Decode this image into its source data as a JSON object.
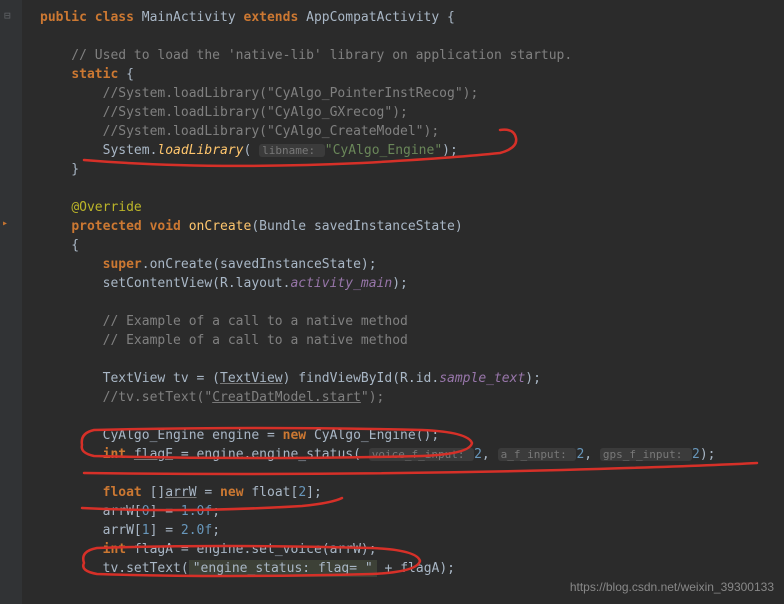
{
  "code": {
    "line1": "public class MainActivity extends AppCompatActivity {",
    "blank1": "",
    "comment_header": "    // Used to load the 'native-lib' library on application startup.",
    "static_open": "    static {",
    "static_c1": "        //System.loadLibrary(\"CyAlgo_PointerInstRecog\");",
    "static_c2": "        //System.loadLibrary(\"CyAlgo_GXrecog\");",
    "static_c3": "        //System.loadLibrary(\"CyAlgo_CreateModel\");",
    "loadlib_pre": "        System.",
    "loadlib_method": "loadLibrary",
    "loadlib_open": "( ",
    "loadlib_hint": "libname: ",
    "loadlib_str": "\"CyAlgo_Engine\"",
    "loadlib_close": ");",
    "static_close": "    }",
    "blank2": "",
    "override": "    @Override",
    "oncreate_sig1": "    protected void onCreate(Bundle savedInstanceState)",
    "brace_open": "    {",
    "super_call": "        super.onCreate(savedInstanceState);",
    "setcontent_pre": "        setContentView(R.layout.",
    "setcontent_field": "activity_main",
    "setcontent_close": ");",
    "blank3": "",
    "comment_ex1": "        // Example of a call to a native method",
    "comment_ex2": "        // Example of a call to a native method",
    "blank4": "",
    "tv_decl_pre": "        TextView tv = (",
    "tv_cast": "TextView",
    "tv_decl_mid": ") findViewById(R.id.",
    "tv_field": "sample_text",
    "tv_decl_close": ");",
    "tv_commented": "        //tv.setText(\"CreatDatModel.start\");",
    "blank5": "",
    "engine_new_pre": "        CyAlgo_Engine engine = ",
    "engine_new_kw": "new",
    "engine_new_post": " CyAlgo_Engine();",
    "flage_pre": "        int ",
    "flage_var": "flagE",
    "flage_mid": " = engine.engine_status( ",
    "flage_h1": "voice_f_input: ",
    "flage_v1": "2",
    "flage_sep1": ", ",
    "flage_h2": "a_f_input: ",
    "flage_v2": "2",
    "flage_sep2": ", ",
    "flage_h3": "gps_f_input: ",
    "flage_v3": "2",
    "flage_close": ");",
    "blank6": "",
    "arrw_pre": "        float []",
    "arrw_var": "arrW",
    "arrw_mid": " = ",
    "arrw_new": "new",
    "arrw_post": " float[",
    "arrw_size": "2",
    "arrw_close": "];",
    "arrw0_pre": "        arrW[",
    "arrw0_idx": "0",
    "arrw0_mid": "] = ",
    "arrw0_val": "1.0f",
    "arrw0_close": ";",
    "arrw1_pre": "        arrW[",
    "arrw1_idx": "1",
    "arrw1_mid": "] = ",
    "arrw1_val": "2.0f",
    "arrw1_close": ";",
    "flaga_pre": "        int flagA = engine.set_voice(arrW);",
    "settext_pre": "        tv.setText(",
    "settext_hl": "\"engine_status: flag= \"",
    "settext_post": " + flagA);"
  },
  "watermark": "https://blog.csdn.net/weixin_39300133"
}
